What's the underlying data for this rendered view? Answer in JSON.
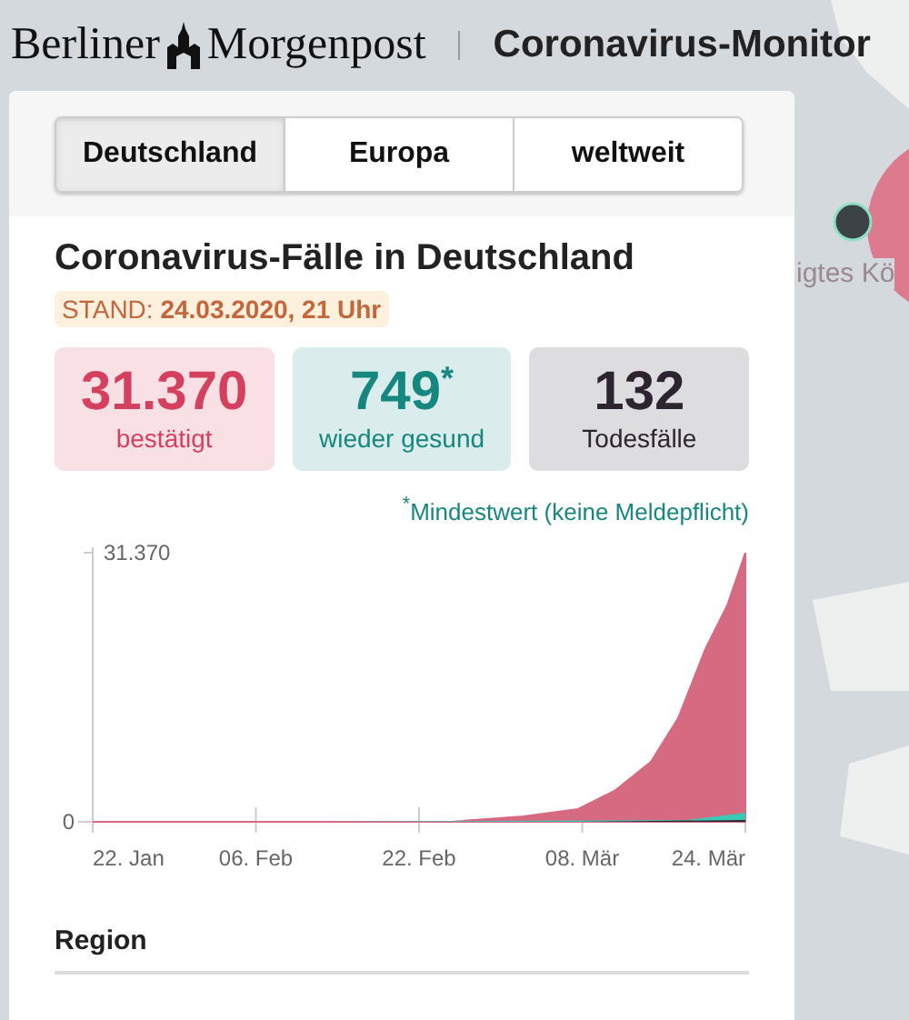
{
  "header": {
    "brand": "Berliner",
    "brand_2": "Morgenpost",
    "title": "Coronavirus-Monitor"
  },
  "map": {
    "label": "igtes Kö"
  },
  "tabs": [
    {
      "label": "Deutschland",
      "selected": true
    },
    {
      "label": "Europa",
      "selected": false
    },
    {
      "label": "weltweit",
      "selected": false
    }
  ],
  "heading": "Coronavirus-Fälle in Deutschland",
  "stand": {
    "label": "STAND:",
    "value": "24.03.2020, 21 Uhr"
  },
  "stats": [
    {
      "value": "31.370",
      "label": "bestätigt",
      "color": "#d4405e"
    },
    {
      "value": "749$^{*}$",
      "label": "wieder gesund",
      "color": "#16877f"
    },
    {
      "value": "132",
      "label": "Todesfälle",
      "color": "#2c2530"
    }
  ],
  "footnote": "$^{*}$Mindestwert (keine Meldepflicht)",
  "chart": {
    "y_labels": [
      "31.370",
      "0"
    ],
    "x_labels": [
      "22. Jan",
      "06. Feb",
      "22. Feb",
      "08. Mär",
      "24. Mär"
    ]
  },
  "region": {
    "heading": "Region"
  }
}
